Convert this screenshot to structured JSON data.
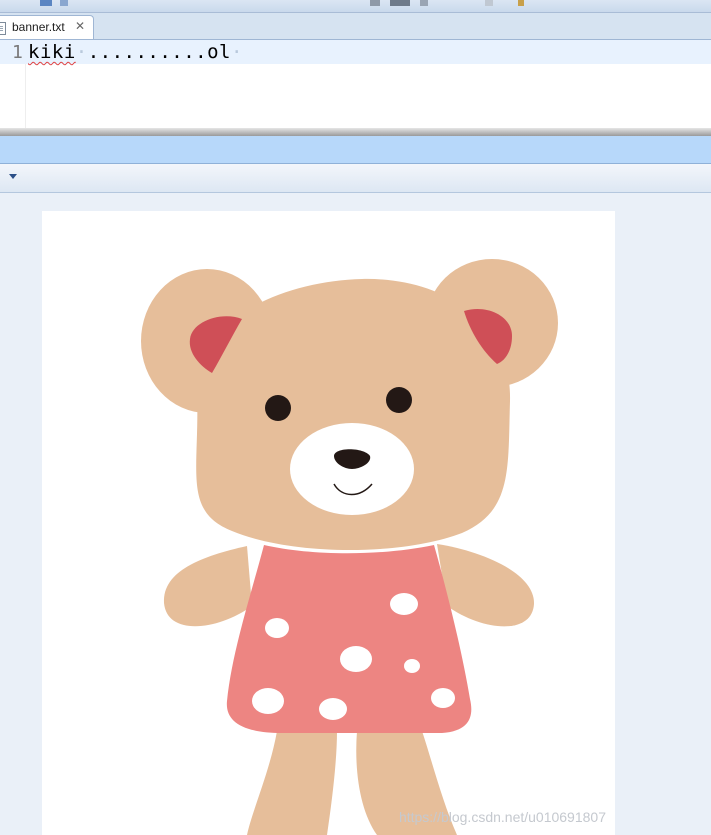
{
  "editor": {
    "tab": {
      "filename": "banner.txt",
      "close_glyph": "✕"
    },
    "line_number": "1",
    "line_text": {
      "part1": "kiki",
      "sep1": "·",
      "part2": "..........ol",
      "sep2": "·"
    }
  },
  "preview": {
    "image_subject": "teddy-bear-illustration",
    "watermark": "https://blog.csdn.net/u010691807"
  },
  "colors": {
    "bear_fur": "#e6be9a",
    "inner_ear": "#cf4f57",
    "dress": "#ed8582",
    "muzzle": "#ffffff",
    "features": "#231815"
  },
  "icons": {
    "file": "text-file-icon",
    "close": "close-icon",
    "view_menu": "chevron-down-icon"
  }
}
